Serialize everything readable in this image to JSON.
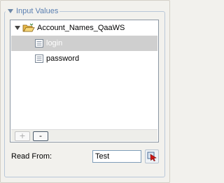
{
  "group": {
    "title": "Input Values",
    "collapse_icon": "triangle-down-icon"
  },
  "tree": {
    "root": {
      "label": "Account_Names_QaaWS",
      "icon": "open-folder-icon",
      "expanded": true
    },
    "children": [
      {
        "label": "login",
        "icon": "document-icon",
        "selected": true
      },
      {
        "label": "password",
        "icon": "document-icon",
        "selected": false
      }
    ],
    "add_label": "+",
    "remove_label": "-",
    "add_enabled": false
  },
  "read_from": {
    "label": "Read From:",
    "value": "Test",
    "picker_icon": "cursor-picker-icon"
  },
  "colors": {
    "legend_text": "#5a7fb1",
    "selection": "#cfcfcf",
    "picker_arrow": "#d01818"
  }
}
